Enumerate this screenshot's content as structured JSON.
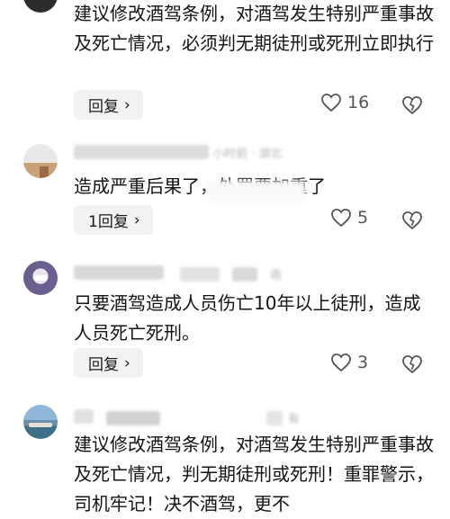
{
  "comments": [
    {
      "text": "建议修改酒驾条例，对酒驾发生特别严重事故及死亡情况，必须判无期徒刑或死刑立即执行",
      "meta": "",
      "reply_label": "回复",
      "likes": "16"
    },
    {
      "text": "造成严重后果了，处罚要加重了",
      "meta": "小时前 · 湖北",
      "reply_label": "1回复",
      "likes": "5"
    },
    {
      "text": "只要酒驾造成人员伤亡10年以上徒刑，造成人员死亡死刑。",
      "meta": "南",
      "reply_label": "回复",
      "likes": "3"
    },
    {
      "text": "建议修改酒驾条例，对酒驾发生特别严重事故及死亡情况，判无期徒刑或死刑！重罪警示，司机牢记！决不酒驾，更不",
      "meta": "有",
      "reply_label": "",
      "likes": ""
    }
  ],
  "chevron": "›",
  "icons": {
    "like": "heart-outline-icon",
    "dislike": "broken-heart-icon"
  },
  "colors": {
    "reply_bg": "#f2f2f2",
    "icon": "#555555"
  }
}
